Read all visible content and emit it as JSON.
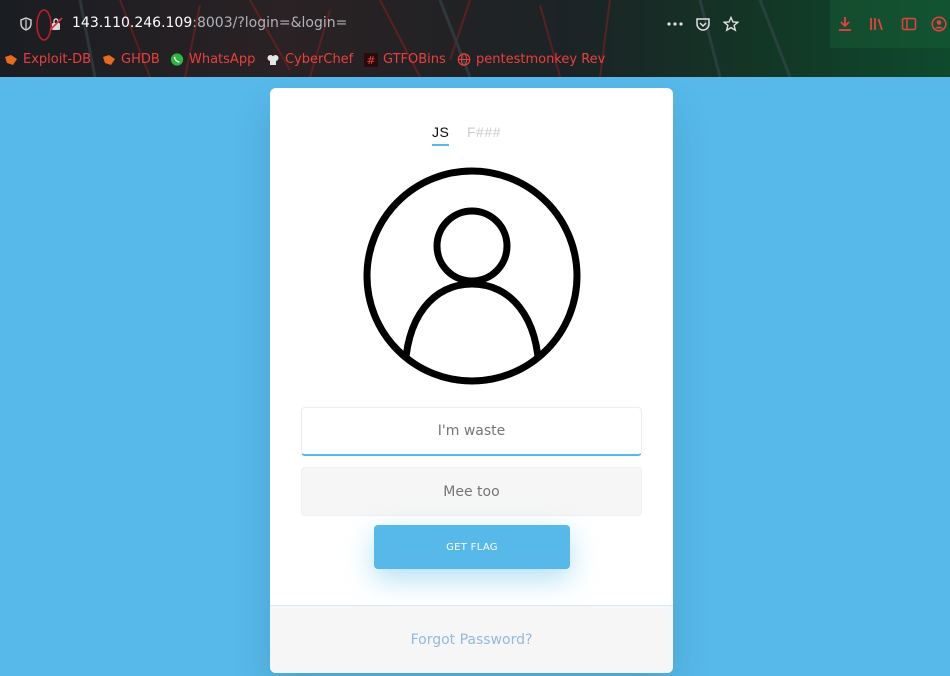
{
  "browser": {
    "url_host": "143.110.246.109",
    "url_rest": ":8003/?login=&login=",
    "toolbar_icons": [
      "more-icon",
      "pocket-icon",
      "star-icon",
      "download-icon",
      "library-icon",
      "sidebar-icon",
      "account-icon"
    ],
    "bookmarks": [
      {
        "label": "Exploit-DB",
        "icon": "exploitdb-icon"
      },
      {
        "label": "GHDB",
        "icon": "ghdb-icon"
      },
      {
        "label": "WhatsApp",
        "icon": "whatsapp-icon"
      },
      {
        "label": "CyberChef",
        "icon": "cyberchef-icon"
      },
      {
        "label": "GTFOBins",
        "icon": "gtfobins-icon"
      },
      {
        "label": "pentestmonkey Rev",
        "icon": "globe-icon"
      }
    ]
  },
  "login": {
    "tabs": [
      {
        "label": "JS",
        "active": true
      },
      {
        "label": "F###",
        "active": false
      }
    ],
    "username_placeholder": "I'm waste",
    "password_placeholder": "Mee too",
    "submit_label": "GET FLAG",
    "forgot_label": "Forgot Password?"
  },
  "colors": {
    "page_background": "#56b9ea",
    "accent": "#56b9ea",
    "bookmark_text": "#e8403f",
    "forgot_link": "#92badd"
  }
}
